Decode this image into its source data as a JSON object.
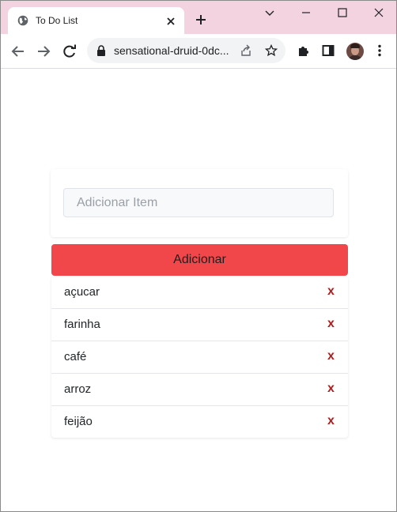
{
  "browser": {
    "tab_title": "To Do List",
    "url": "sensational-druid-0dc..."
  },
  "app": {
    "input_placeholder": "Adicionar Item",
    "input_value": "",
    "add_button_label": "Adicionar",
    "add_button_color": "#f1474a",
    "delete_symbol": "x",
    "items": [
      {
        "label": "açucar"
      },
      {
        "label": "farinha"
      },
      {
        "label": "café"
      },
      {
        "label": "arroz"
      },
      {
        "label": "feijão"
      }
    ]
  }
}
